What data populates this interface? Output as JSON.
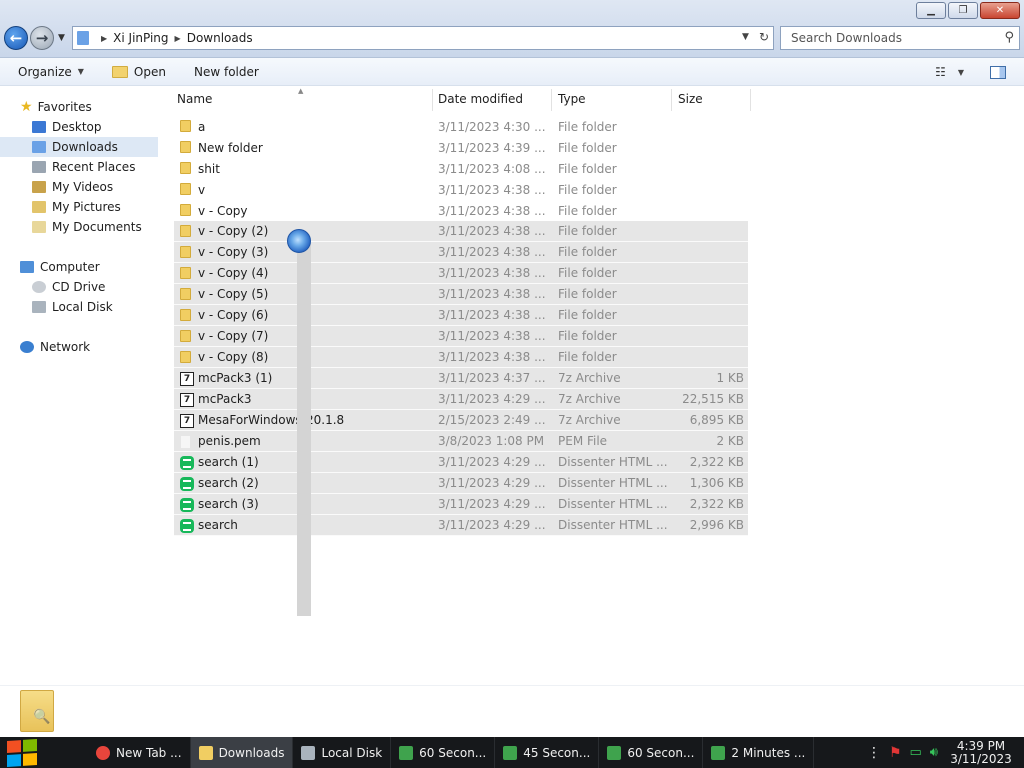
{
  "window": {
    "address": {
      "crumbs": [
        "Xi JinPing",
        "Downloads"
      ]
    },
    "search_placeholder": "Search Downloads"
  },
  "toolbar": {
    "organize": "Organize",
    "open": "Open",
    "new_folder": "New folder"
  },
  "sidebar": {
    "favorites": "Favorites",
    "items": [
      {
        "label": "Desktop",
        "icon": "desktop-icon"
      },
      {
        "label": "Downloads",
        "icon": "downloads-icon"
      },
      {
        "label": "Recent Places",
        "icon": "recent-places-icon"
      },
      {
        "label": "My Videos",
        "icon": "videos-icon"
      },
      {
        "label": "My Pictures",
        "icon": "pictures-icon"
      },
      {
        "label": "My Documents",
        "icon": "documents-icon"
      }
    ],
    "computer": "Computer",
    "computer_items": [
      {
        "label": "CD Drive",
        "icon": "cd-drive-icon"
      },
      {
        "label": "Local Disk",
        "icon": "local-disk-icon"
      }
    ],
    "network": "Network"
  },
  "columns": {
    "name": "Name",
    "date": "Date modified",
    "type": "Type",
    "size": "Size"
  },
  "files": [
    {
      "name": "a",
      "date": "3/11/2023 4:30 ...",
      "type": "File folder",
      "size": "",
      "icon": "folder-icon",
      "selected": false
    },
    {
      "name": "New folder",
      "date": "3/11/2023 4:39 ...",
      "type": "File folder",
      "size": "",
      "icon": "folder-icon",
      "selected": false
    },
    {
      "name": "shit",
      "date": "3/11/2023 4:08 ...",
      "type": "File folder",
      "size": "",
      "icon": "folder-icon",
      "selected": false
    },
    {
      "name": "v",
      "date": "3/11/2023 4:38 ...",
      "type": "File folder",
      "size": "",
      "icon": "folder-icon",
      "selected": false
    },
    {
      "name": "v - Copy",
      "date": "3/11/2023 4:38 ...",
      "type": "File folder",
      "size": "",
      "icon": "folder-icon",
      "selected": false
    },
    {
      "name": "v - Copy (2)",
      "date": "3/11/2023 4:38 ...",
      "type": "File folder",
      "size": "",
      "icon": "folder-icon",
      "selected": true
    },
    {
      "name": "v - Copy (3)",
      "date": "3/11/2023 4:38 ...",
      "type": "File folder",
      "size": "",
      "icon": "folder-icon",
      "selected": true
    },
    {
      "name": "v - Copy (4)",
      "date": "3/11/2023 4:38 ...",
      "type": "File folder",
      "size": "",
      "icon": "folder-icon",
      "selected": true
    },
    {
      "name": "v - Copy (5)",
      "date": "3/11/2023 4:38 ...",
      "type": "File folder",
      "size": "",
      "icon": "folder-icon",
      "selected": true
    },
    {
      "name": "v - Copy (6)",
      "date": "3/11/2023 4:38 ...",
      "type": "File folder",
      "size": "",
      "icon": "folder-icon",
      "selected": true
    },
    {
      "name": "v - Copy (7)",
      "date": "3/11/2023 4:38 ...",
      "type": "File folder",
      "size": "",
      "icon": "folder-icon",
      "selected": true
    },
    {
      "name": "v - Copy (8)",
      "date": "3/11/2023 4:38 ...",
      "type": "File folder",
      "size": "",
      "icon": "folder-icon",
      "selected": true
    },
    {
      "name": "mcPack3 (1)",
      "date": "3/11/2023 4:37 ...",
      "type": "7z Archive",
      "size": "1 KB",
      "icon": "archive-7z-icon",
      "selected": true
    },
    {
      "name": "mcPack3",
      "date": "3/11/2023 4:29 ...",
      "type": "7z Archive",
      "size": "22,515 KB",
      "icon": "archive-7z-icon",
      "selected": true
    },
    {
      "name": "MesaForWindows-20.1.8",
      "date": "2/15/2023 2:49 ...",
      "type": "7z Archive",
      "size": "6,895 KB",
      "icon": "archive-7z-icon",
      "selected": true
    },
    {
      "name": "penis.pem",
      "date": "3/8/2023 1:08 PM",
      "type": "PEM File",
      "size": "2 KB",
      "icon": "pem-file-icon",
      "selected": true
    },
    {
      "name": "search (1)",
      "date": "3/11/2023 4:29 ...",
      "type": "Dissenter HTML ...",
      "size": "2,322 KB",
      "icon": "html-file-icon",
      "selected": true
    },
    {
      "name": "search (2)",
      "date": "3/11/2023 4:29 ...",
      "type": "Dissenter HTML ...",
      "size": "1,306 KB",
      "icon": "html-file-icon",
      "selected": true
    },
    {
      "name": "search (3)",
      "date": "3/11/2023 4:29 ...",
      "type": "Dissenter HTML ...",
      "size": "2,322 KB",
      "icon": "html-file-icon",
      "selected": true
    },
    {
      "name": "search",
      "date": "3/11/2023 4:29 ...",
      "type": "Dissenter HTML ...",
      "size": "2,996 KB",
      "icon": "html-file-icon",
      "selected": true
    }
  ],
  "taskbar": {
    "items": [
      {
        "label": "New Tab ...",
        "icon": "chrome-icon",
        "active": false
      },
      {
        "label": "Downloads",
        "icon": "explorer-folder-icon",
        "active": true
      },
      {
        "label": "Local Disk",
        "icon": "local-disk-icon",
        "active": false
      },
      {
        "label": "60 Secon...",
        "icon": "app-window-icon",
        "active": false
      },
      {
        "label": "45 Secon...",
        "icon": "app-window-icon",
        "active": false
      },
      {
        "label": "60 Secon...",
        "icon": "app-window-icon",
        "active": false
      },
      {
        "label": "2 Minutes ...",
        "icon": "app-window-icon",
        "active": false
      }
    ],
    "time": "4:39 PM",
    "date": "3/11/2023"
  },
  "colors": {
    "accent": "#1858b6",
    "selection": "#e6e6e6",
    "taskbar": "#16181b",
    "folder": "#f1ce62",
    "html_icon": "#17b85a"
  }
}
